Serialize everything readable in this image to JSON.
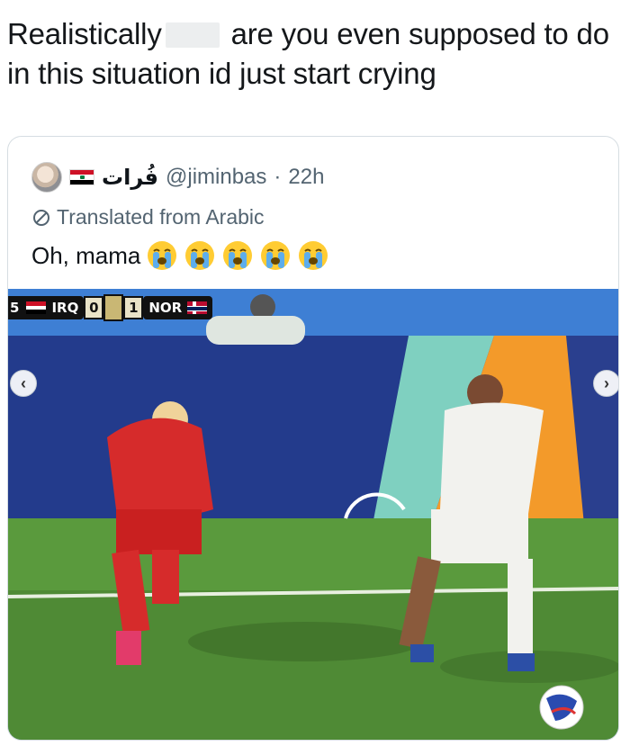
{
  "post": {
    "text_before_redaction": "Realistically",
    "text_after_redaction": " are you even supposed to do in this situation id just start crying"
  },
  "quoted_tweet": {
    "display_name": "فُرات",
    "handle": "@jiminbas",
    "separator": "·",
    "time": "22h",
    "translated_label": "Translated from Arabic",
    "text": "Oh, mama",
    "emoji_count": 5,
    "emoji_name": "loudly-crying-face"
  },
  "scorebug": {
    "left_edge_text": "5",
    "home_team": "IRQ",
    "home_score": "0",
    "away_score": "1",
    "away_team": "NOR"
  },
  "colors": {
    "handle_gray": "#536471",
    "card_border": "#d6dde2",
    "pitch_green": "#4f8a35",
    "board_blue": "#223a8a",
    "board_orange": "#f39a2a"
  },
  "icons": {
    "prev": "chevron-left-icon",
    "next": "chevron-right-icon",
    "translate": "translate-icon"
  }
}
